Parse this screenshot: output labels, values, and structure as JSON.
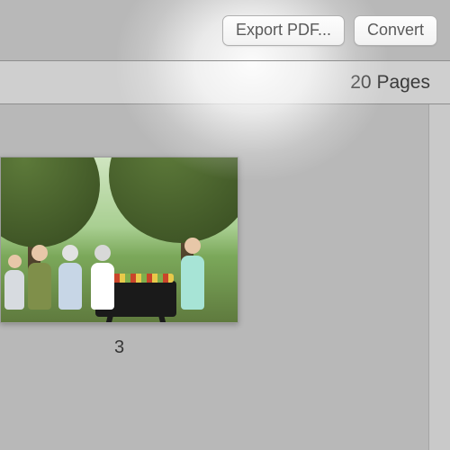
{
  "toolbar": {
    "export_pdf_label": "Export PDF...",
    "convert_label": "Convert"
  },
  "subheader": {
    "page_count": "20 Pages"
  },
  "thumbnails": [
    {
      "page_number": "3"
    }
  ]
}
